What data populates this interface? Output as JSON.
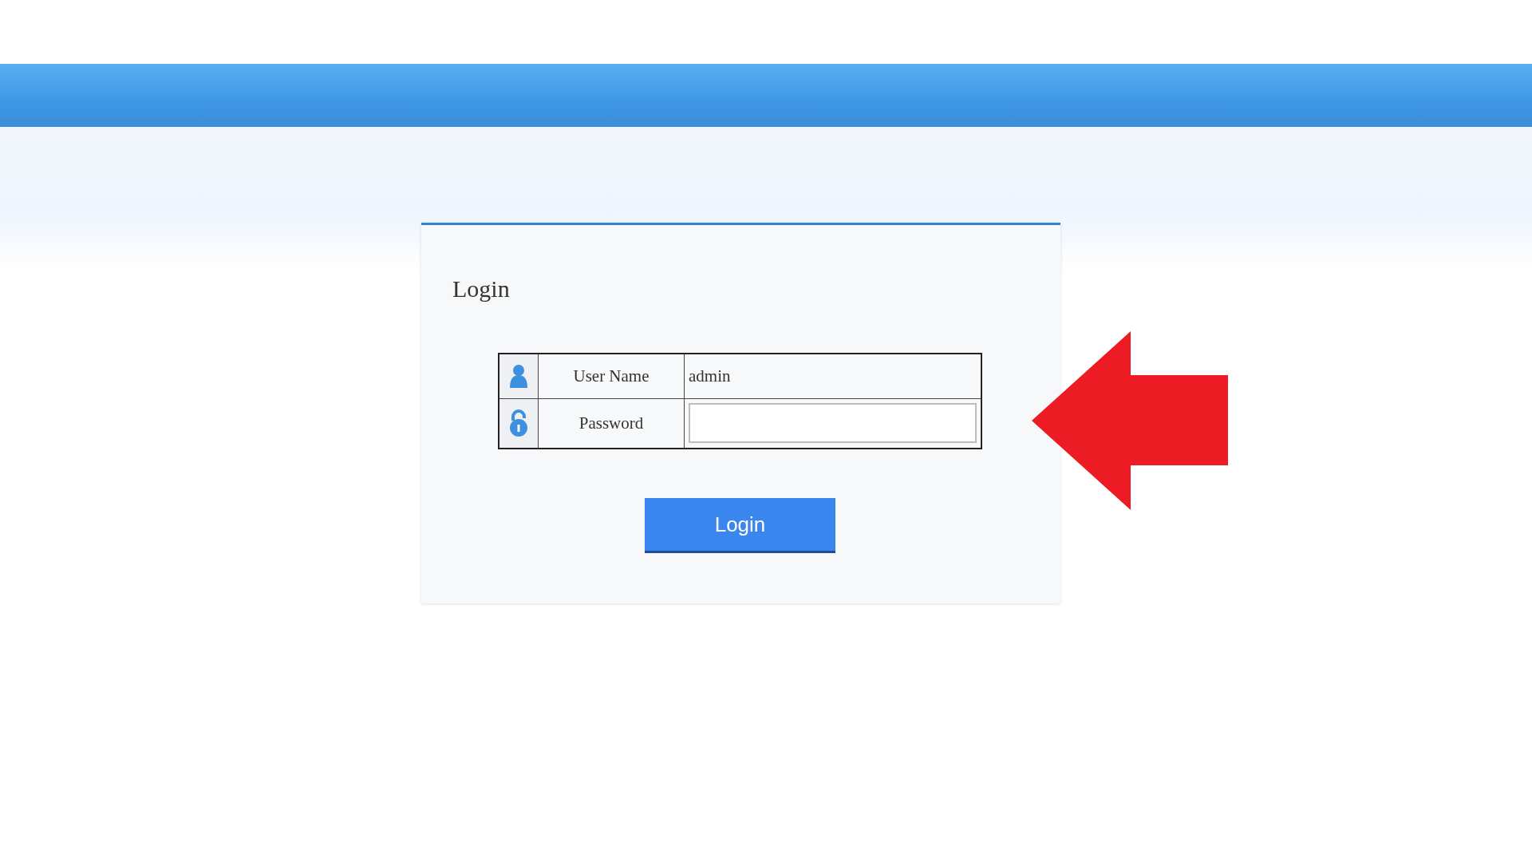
{
  "login": {
    "title": "Login",
    "fields": [
      {
        "kind": "text",
        "label": "User Name",
        "value": "admin"
      },
      {
        "kind": "password",
        "label": "Password"
      }
    ],
    "button": "Login"
  }
}
